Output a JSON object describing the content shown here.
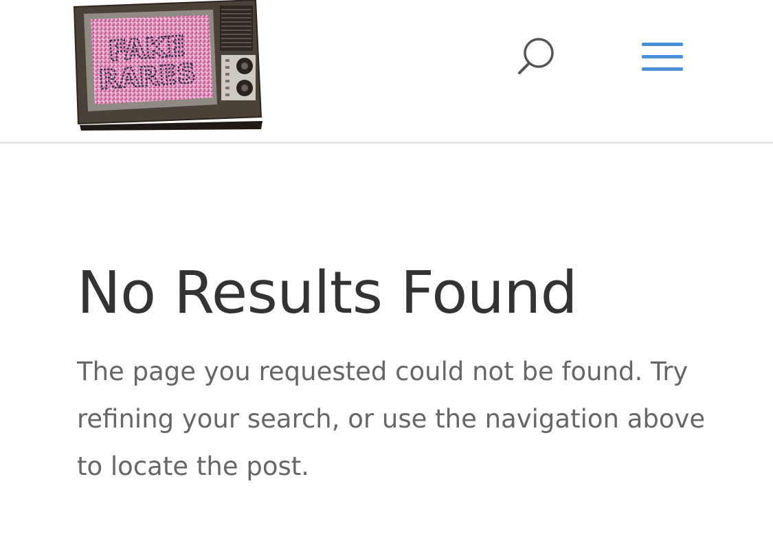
{
  "header": {
    "logo": {
      "alt": "Fake Rares",
      "line1": "FAKE",
      "line2": "RARES",
      "screen_color": "#e08ab8",
      "cabinet_color": "#4a4138"
    },
    "search_icon": "search-icon",
    "menu_icon": "hamburger-menu-icon",
    "menu_color": "#4a90d9"
  },
  "main": {
    "title": "No Results Found",
    "message": "The page you requested could not be found. Try refining your search, or use the navigation above to locate the post."
  }
}
